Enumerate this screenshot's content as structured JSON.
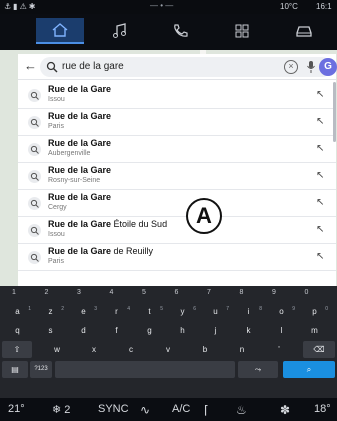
{
  "status": {
    "left_icons": "⚓▮⚠✱",
    "center": "— • —",
    "temperature": "10°C",
    "time": "16:1"
  },
  "nav": {
    "tabs": [
      {
        "icon": "home-icon",
        "active": true
      },
      {
        "icon": "music-icon",
        "active": false
      },
      {
        "icon": "phone-icon",
        "active": false
      },
      {
        "icon": "apps-icon",
        "active": false
      },
      {
        "icon": "car-icon",
        "active": false
      }
    ]
  },
  "search": {
    "query": "rue de la gare",
    "avatar_letter": "G"
  },
  "results": [
    {
      "title": "Rue de la Gare",
      "rest": "",
      "sub": "Issou"
    },
    {
      "title": "Rue de la Gare",
      "rest": "",
      "sub": "Paris"
    },
    {
      "title": "Rue de la Gare",
      "rest": "",
      "sub": "Aubergenville"
    },
    {
      "title": "Rue de la Gare",
      "rest": "",
      "sub": "Rosny-sur-Seine"
    },
    {
      "title": "Rue de la Gare",
      "rest": "",
      "sub": "Cergy"
    },
    {
      "title": "Rue de la Gare",
      "rest": " Étoile du Sud",
      "sub": "Issou"
    },
    {
      "title": "Rue de la Gare",
      "rest": " de Reuilly",
      "sub": "Paris"
    }
  ],
  "callout": "A",
  "keyboard": {
    "numbers": [
      "1",
      "2",
      "3",
      "4",
      "5",
      "6",
      "7",
      "8",
      "9",
      "0"
    ],
    "row1": [
      {
        "k": "a",
        "s": "1"
      },
      {
        "k": "z",
        "s": "2"
      },
      {
        "k": "e",
        "s": "3"
      },
      {
        "k": "r",
        "s": "4"
      },
      {
        "k": "t",
        "s": "5"
      },
      {
        "k": "y",
        "s": "6"
      },
      {
        "k": "u",
        "s": "7"
      },
      {
        "k": "i",
        "s": "8"
      },
      {
        "k": "o",
        "s": "9"
      },
      {
        "k": "p",
        "s": "0"
      }
    ],
    "row2": [
      "q",
      "s",
      "d",
      "f",
      "g",
      "h",
      "j",
      "k",
      "l",
      "m"
    ],
    "row3": [
      "w",
      "x",
      "c",
      "v",
      "b",
      "n",
      "'"
    ],
    "shift_label": "⇧",
    "backspace_label": "⌫",
    "symbols_label": "?123",
    "emoji_label": "▤",
    "lang_label": "⤳",
    "search_label": "⌕"
  },
  "climate": {
    "left_temp": "21°",
    "fan": "❄ 2",
    "sync": "SYNC",
    "ac": "A/C",
    "right_temp": "18°"
  }
}
